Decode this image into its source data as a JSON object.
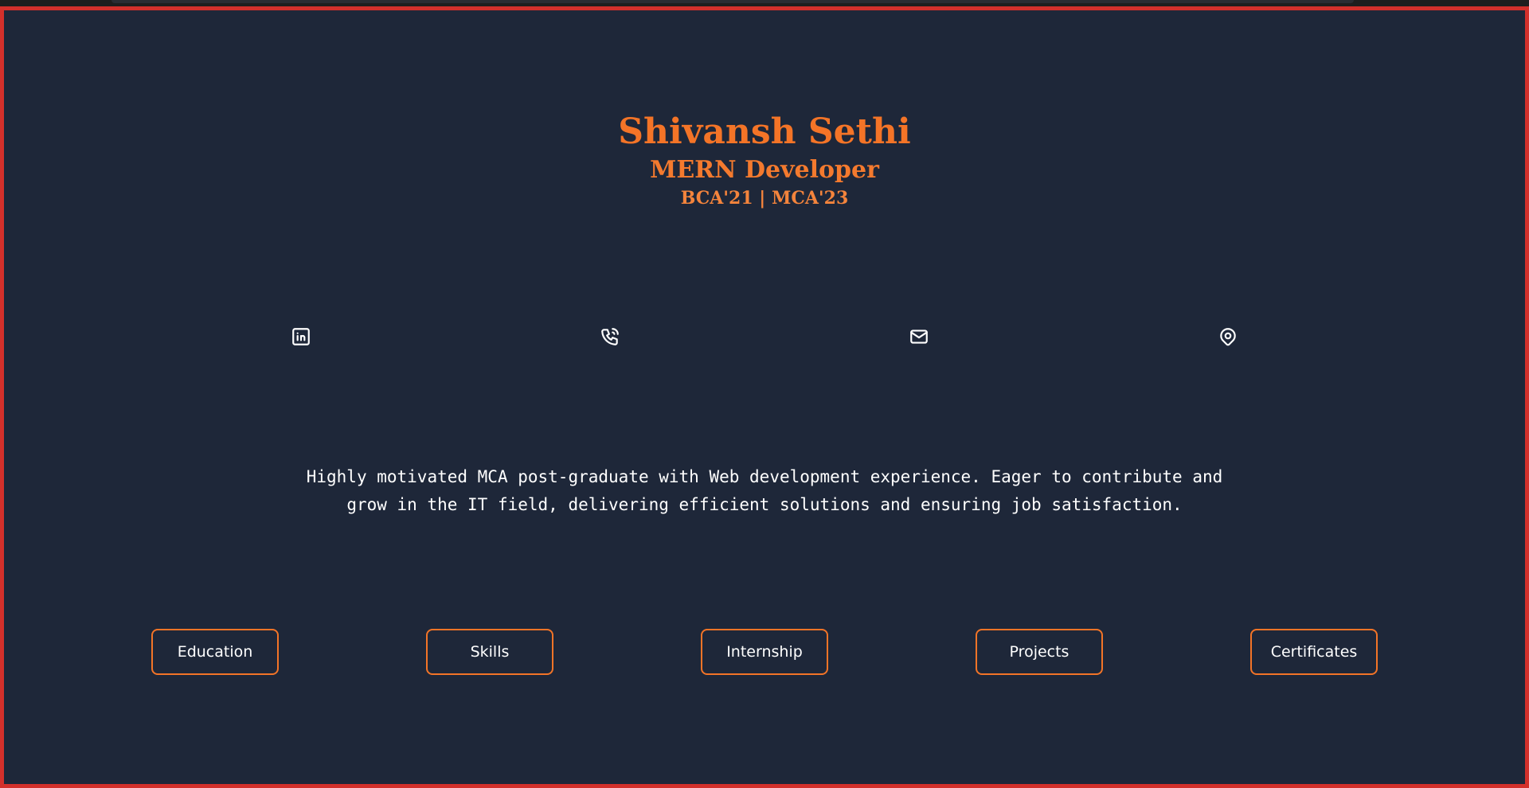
{
  "profile": {
    "name": "Shivansh Sethi",
    "role": "MERN Developer",
    "degrees": "BCA'21 | MCA'23"
  },
  "contacts": [
    {
      "icon": "linkedin-icon"
    },
    {
      "icon": "phone-call-icon"
    },
    {
      "icon": "mail-icon"
    },
    {
      "icon": "map-pin-icon"
    }
  ],
  "summary": {
    "line1": "Highly motivated MCA post-graduate with Web development experience. Eager to contribute and",
    "line2": "grow in the IT field, delivering efficient solutions and ensuring job satisfaction."
  },
  "nav": {
    "education": "Education",
    "skills": "Skills",
    "internship": "Internship",
    "projects": "Projects",
    "certificates": "Certificates"
  },
  "colors": {
    "background": "#1e2739",
    "accent": "#f37427",
    "border": "#d3302b",
    "text": "#ffffff"
  }
}
